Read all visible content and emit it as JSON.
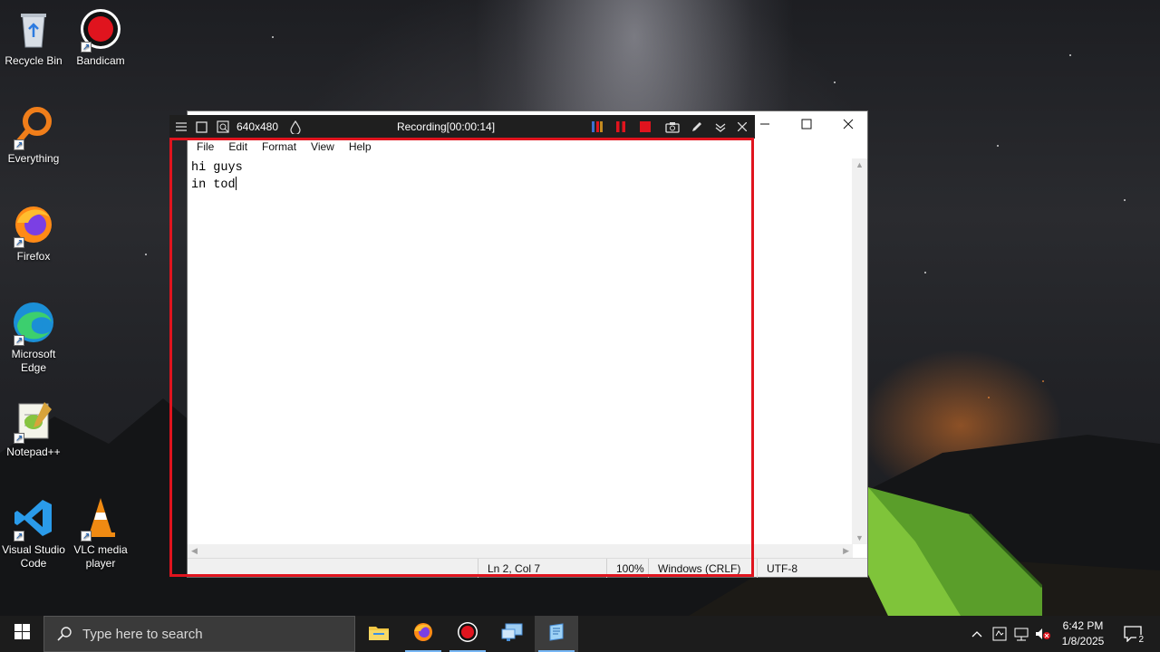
{
  "desktop_icons": [
    {
      "label": "Recycle Bin"
    },
    {
      "label": "Bandicam"
    },
    {
      "label": "Everything"
    },
    {
      "label": "Firefox"
    },
    {
      "label": "Microsoft Edge"
    },
    {
      "label": "Notepad++"
    },
    {
      "label": "Visual Studio Code"
    },
    {
      "label": "VLC media player"
    }
  ],
  "bandicam": {
    "resolution": "640x480",
    "recording_status": "Recording[00:00:14]",
    "colors": {
      "bar": "#1f1f1f",
      "frame": "#e0141e",
      "pause": "#e0141e",
      "stop": "#e0141e"
    }
  },
  "notepad": {
    "menu": {
      "file": "File",
      "edit": "Edit",
      "format": "Format",
      "view": "View",
      "help": "Help"
    },
    "content": {
      "line1": "hi guys",
      "line2": "in tod"
    },
    "status": {
      "position": "Ln 2, Col 7",
      "zoom": "100%",
      "line_ending": "Windows (CRLF)",
      "encoding": "UTF-8"
    },
    "controls": {
      "minimize_icon": "minimize-icon",
      "maximize_icon": "maximize-icon",
      "close_icon": "close-icon"
    }
  },
  "taskbar": {
    "search_placeholder": "Type here to search",
    "apps": [
      "file-explorer",
      "firefox",
      "bandicam",
      "remote-desktop",
      "notepad"
    ],
    "clock": {
      "time": "6:42 PM",
      "date": "1/8/2025"
    },
    "notifications_count": "2",
    "accent": "#77b7f5"
  }
}
